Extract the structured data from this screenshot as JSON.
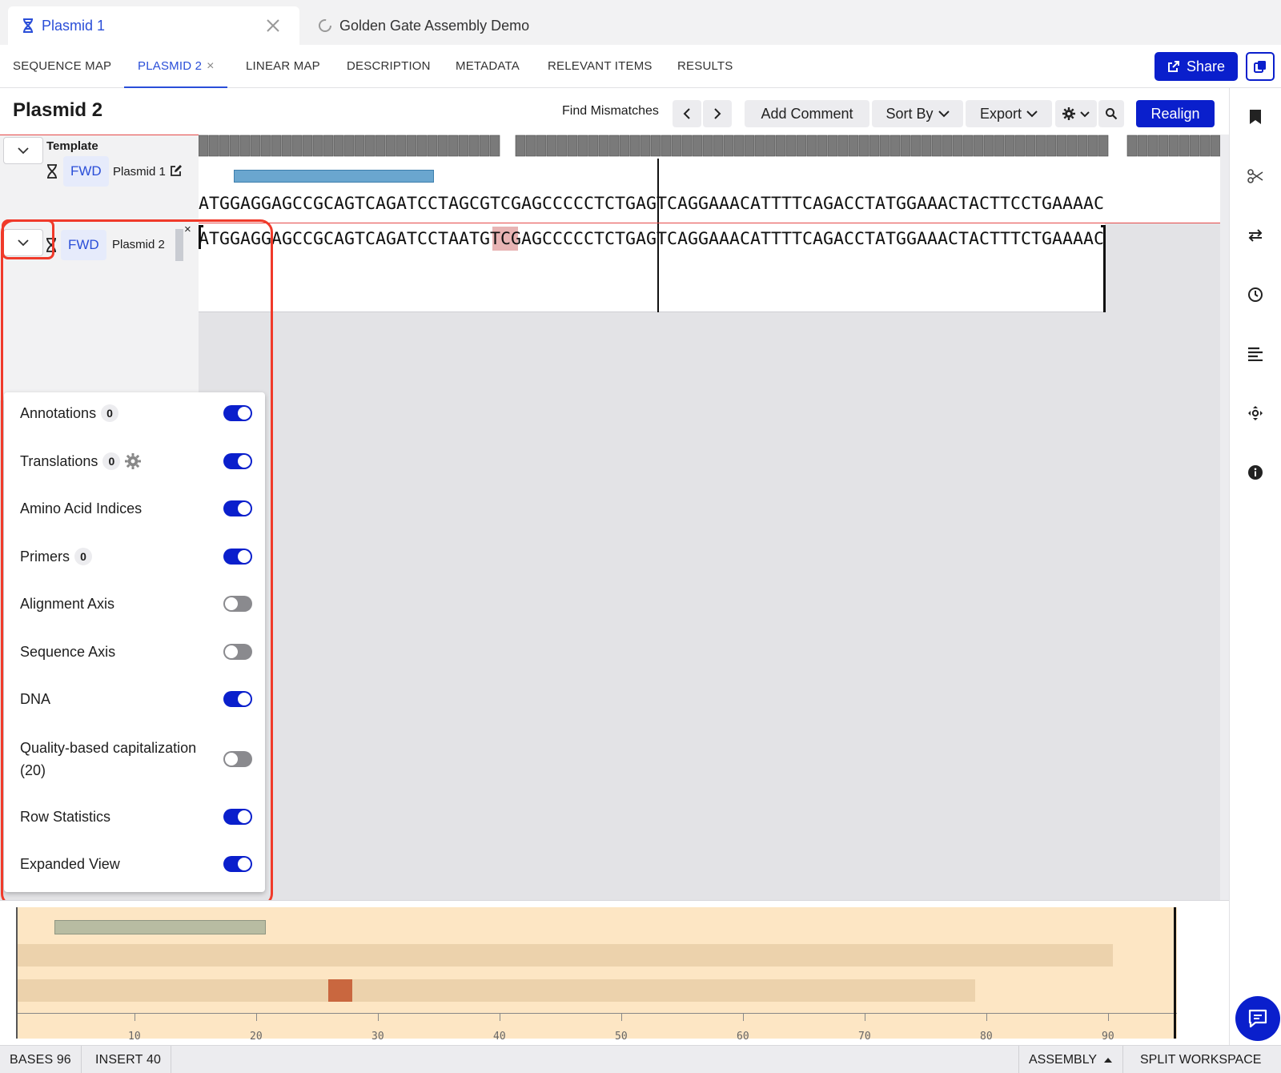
{
  "file_tabs": [
    {
      "label": "Plasmid 1",
      "icon": "dna-icon",
      "active": true
    },
    {
      "label": "Golden Gate Assembly Demo",
      "icon": "loading-spinner-icon",
      "active": false
    }
  ],
  "section_nav": {
    "items": [
      {
        "label": "SEQUENCE MAP"
      },
      {
        "label": "PLASMID 2",
        "closable": true,
        "active": true
      },
      {
        "label": "LINEAR MAP"
      },
      {
        "label": "DESCRIPTION"
      },
      {
        "label": "METADATA"
      },
      {
        "label": "RELEVANT ITEMS"
      },
      {
        "label": "RESULTS"
      }
    ],
    "close_glyph": "×",
    "share_label": "Share"
  },
  "toolbar": {
    "title": "Plasmid 2",
    "find_mismatches_label": "Find Mismatches",
    "add_comment_label": "Add Comment",
    "sort_by_label": "Sort By",
    "export_label": "Export",
    "realign_label": "Realign"
  },
  "alignment": {
    "template": {
      "label": "Template",
      "direction": "FWD",
      "name": "Plasmid 1",
      "sequence": "ATGGAGGAGCCGCAGTCAGATCCTAGCGTCGAGCCCCCTCTGAGTCAGGAAACATTTTCAGACCTATGGAAACTACTTCCTGAAAAC"
    },
    "rows": [
      {
        "direction": "FWD",
        "name": "Plasmid 2",
        "close_glyph": "×",
        "sequence": "ATGGAGGAGCCGCAGTCAGATCCTAATGTCGAGCCCCCTCTGAGTCAGGAAACATTTTCAGACCTATGGAAACTACTTTCTGAAAAC"
      }
    ]
  },
  "display_options": [
    {
      "label": "Annotations",
      "count": "0",
      "enabled": true
    },
    {
      "label": "Translations",
      "count": "0",
      "has_settings": true,
      "enabled": true
    },
    {
      "label": "Amino Acid Indices",
      "enabled": true
    },
    {
      "label": "Primers",
      "count": "0",
      "enabled": true
    },
    {
      "label": "Alignment Axis",
      "enabled": false
    },
    {
      "label": "Sequence Axis",
      "enabled": false
    },
    {
      "label": "DNA",
      "enabled": true
    },
    {
      "label": "Quality-based capitalization (20)",
      "enabled": false
    },
    {
      "label": "Row Statistics",
      "enabled": true
    },
    {
      "label": "Expanded View",
      "enabled": true
    }
  ],
  "overview": {
    "ticks": [
      "10",
      "20",
      "30",
      "40",
      "50",
      "60",
      "70",
      "80",
      "90"
    ]
  },
  "status_bar": {
    "bases_key": "BASES",
    "bases_value": "96",
    "insert_key": "INSERT",
    "insert_value": "40",
    "assembly_label": "ASSEMBLY",
    "split_label": "SPLIT WORKSPACE"
  },
  "colors": {
    "accent": "#0a1fcc",
    "link": "#2a4ed8",
    "mismatch": "#e8b4b4",
    "annotation": "#6aa6cf",
    "overview_bg": "#fde6c4",
    "overview_mismatch": "#c9673f",
    "highlight": "#f03a2a"
  }
}
